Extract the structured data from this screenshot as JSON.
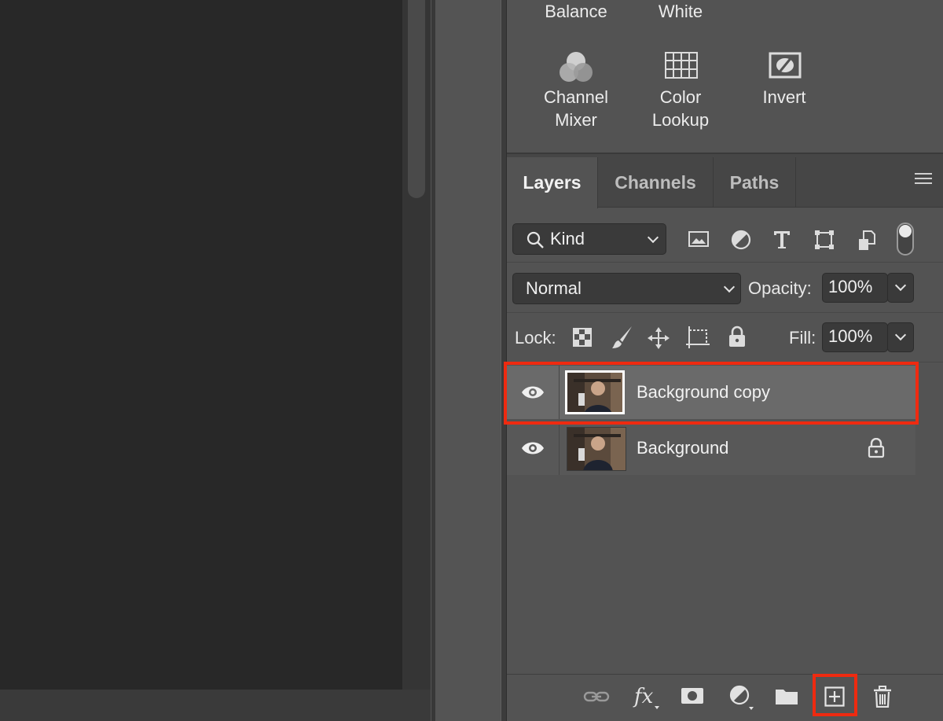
{
  "adjustments": {
    "top_labels": [
      "Balance",
      "White"
    ],
    "items": [
      {
        "label_line1": "Channel",
        "label_line2": "Mixer",
        "icon": "channel-mixer-icon"
      },
      {
        "label_line1": "Color",
        "label_line2": "Lookup",
        "icon": "color-lookup-icon"
      },
      {
        "label_line1": "Invert",
        "label_line2": "",
        "icon": "invert-icon"
      }
    ]
  },
  "layers_panel": {
    "tabs": [
      {
        "label": "Layers",
        "active": true
      },
      {
        "label": "Channels",
        "active": false
      },
      {
        "label": "Paths",
        "active": false
      }
    ],
    "filter": {
      "kind_label": "Kind"
    },
    "blend_mode": "Normal",
    "opacity_label": "Opacity:",
    "opacity_value": "100%",
    "lock_label": "Lock:",
    "fill_label": "Fill:",
    "fill_value": "100%",
    "layers": [
      {
        "name": "Background copy",
        "visible": true,
        "selected": true,
        "locked": false
      },
      {
        "name": "Background",
        "visible": true,
        "selected": false,
        "locked": true
      }
    ]
  },
  "colors": {
    "highlight": "#ef2a10",
    "panel_bg": "#535353",
    "canvas_bg": "#282828"
  }
}
